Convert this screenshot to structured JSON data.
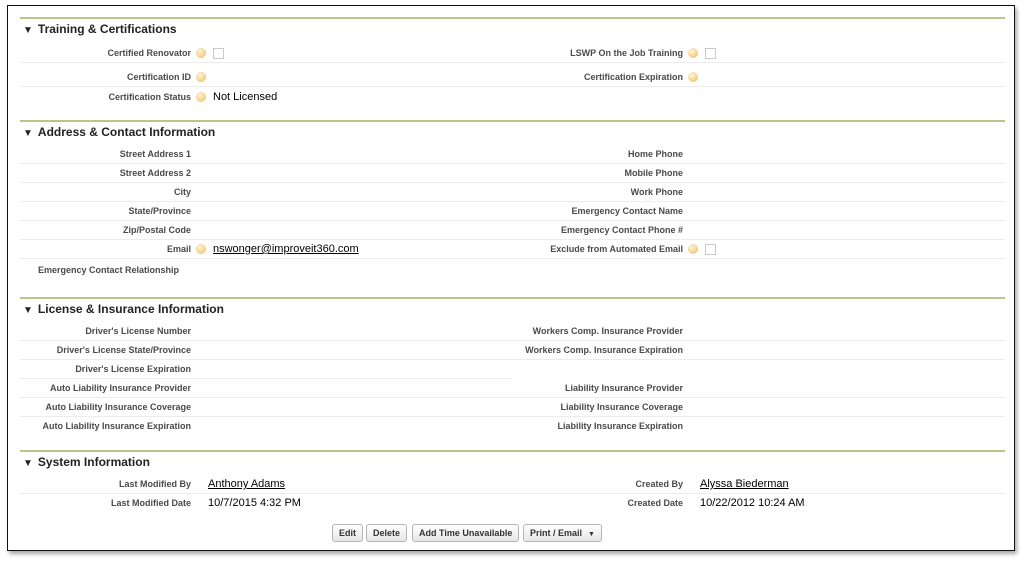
{
  "training": {
    "title": "Training & Certifications",
    "certified_renovator_label": "Certified Renovator",
    "lswp_label": "LSWP On the Job Training",
    "certification_id_label": "Certification ID",
    "certification_expiration_label": "Certification Expiration",
    "certification_status_label": "Certification Status",
    "certification_status_value": "Not Licensed"
  },
  "address": {
    "title": "Address & Contact Information",
    "street1_label": "Street Address 1",
    "street2_label": "Street Address 2",
    "city_label": "City",
    "state_label": "State/Province",
    "zip_label": "Zip/Postal Code",
    "email_label": "Email",
    "email_value": "nswonger@improveit360.com",
    "emergency_relationship_label": "Emergency Contact Relationship",
    "home_phone_label": "Home Phone",
    "mobile_phone_label": "Mobile Phone",
    "work_phone_label": "Work Phone",
    "emergency_name_label": "Emergency Contact Name",
    "emergency_phone_label": "Emergency Contact Phone #",
    "exclude_email_label": "Exclude from Automated Email"
  },
  "license": {
    "title": "License & Insurance Information",
    "dl_number_label": "Driver's License Number",
    "dl_state_label": "Driver's License State/Province",
    "dl_expiration_label": "Driver's License Expiration",
    "auto_provider_label": "Auto Liability Insurance Provider",
    "auto_coverage_label": "Auto Liability Insurance Coverage",
    "auto_expiration_label": "Auto Liability Insurance Expiration",
    "workers_provider_label": "Workers Comp. Insurance Provider",
    "workers_expiration_label": "Workers Comp. Insurance Expiration",
    "liability_provider_label": "Liability Insurance Provider",
    "liability_coverage_label": "Liability Insurance Coverage",
    "liability_expiration_label": "Liability Insurance Expiration"
  },
  "system": {
    "title": "System Information",
    "last_modified_by_label": "Last Modified By",
    "last_modified_by_value": "Anthony Adams",
    "last_modified_date_label": "Last Modified Date",
    "last_modified_date_value": "10/7/2015 4:32 PM",
    "created_by_label": "Created By",
    "created_by_value": "Alyssa Biederman",
    "created_date_label": "Created Date",
    "created_date_value": "10/22/2012 10:24 AM"
  },
  "buttons": {
    "edit": "Edit",
    "delete": "Delete",
    "add_time_unavailable": "Add Time Unavailable",
    "print_email": "Print / Email",
    "dropdown_glyph": "▼"
  },
  "section_toggle_glyph": "▼",
  "colors": {
    "section_rule": "#b8c68b",
    "help_icon": "#f4d48f"
  }
}
